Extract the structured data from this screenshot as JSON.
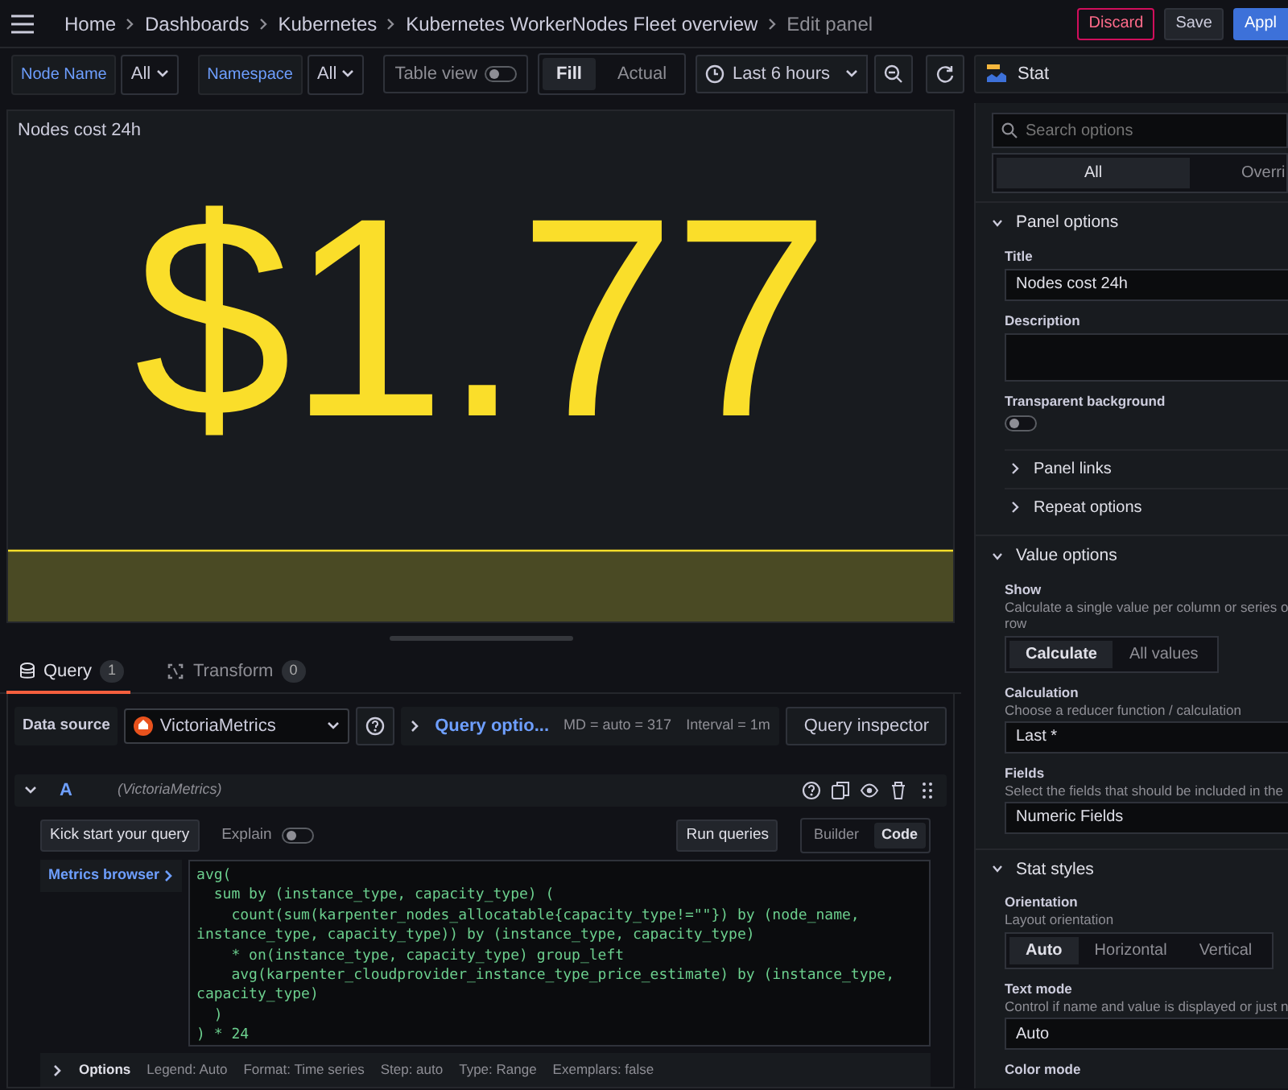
{
  "topbar": {
    "breadcrumbs": [
      "Home",
      "Dashboards",
      "Kubernetes",
      "Kubernetes WorkerNodes Fleet overview",
      "Edit panel"
    ],
    "buttons": [
      {
        "label": "Discard",
        "kind": "danger"
      },
      {
        "label": "Save",
        "kind": "secondary"
      },
      {
        "label": "Appl",
        "kind": "primary"
      }
    ]
  },
  "variables": [
    {
      "label": "Node Name",
      "value": "All"
    },
    {
      "label": "Namespace",
      "value": "All"
    }
  ],
  "table_view": {
    "label": "Table view",
    "on": false
  },
  "size_modes": [
    {
      "label": "Fill",
      "selected": true
    },
    {
      "label": "Actual",
      "selected": false
    }
  ],
  "time_range": "Last 6 hours",
  "visualization": {
    "name": "Stat"
  },
  "panel": {
    "title": "Nodes cost 24h",
    "value": "$1.77"
  },
  "query_tabs": [
    {
      "label": "Query",
      "count": "1",
      "selected": true
    },
    {
      "label": "Transform",
      "count": "0",
      "selected": false
    }
  ],
  "data_source": {
    "label": "Data source",
    "name": "VictoriaMetrics",
    "options_link": "Query optio...",
    "max_data_points": "MD = auto = 317",
    "interval": "Interval = 1m",
    "inspector": "Query inspector"
  },
  "query": {
    "ref": "A",
    "source": "(VictoriaMetrics)",
    "expanded": true,
    "kick_start": "Kick start your query",
    "explain": {
      "label": "Explain",
      "on": false
    },
    "run": "Run queries",
    "modes": [
      {
        "label": "Builder",
        "selected": false
      },
      {
        "label": "Code",
        "selected": true
      }
    ],
    "metrics_browser": "Metrics browser",
    "code_lines": [
      "avg(",
      "  sum by (instance_type, capacity_type) (",
      "    count(sum(karpenter_nodes_allocatable{capacity_type!=\"\"}) by (node_name,",
      "instance_type, capacity_type)) by (instance_type, capacity_type)",
      "    * on(instance_type, capacity_type) group_left",
      "    avg(karpenter_cloudprovider_instance_type_price_estimate) by (instance_type,",
      "capacity_type)",
      "  )",
      ") * 24"
    ],
    "options": {
      "label": "Options",
      "summary": [
        "Legend: Auto",
        "Format: Time series",
        "Step: auto",
        "Type: Range",
        "Exemplars: false"
      ]
    }
  },
  "options_pane": {
    "search_placeholder": "Search options",
    "tabs": [
      {
        "label": "All",
        "selected": true
      },
      {
        "label": "Overri",
        "selected": false
      }
    ],
    "sections": [
      {
        "title": "Panel options",
        "expanded": true,
        "items": [
          {
            "kind": "input",
            "label": "Title",
            "value": "Nodes cost 24h"
          },
          {
            "kind": "textarea",
            "label": "Description"
          },
          {
            "kind": "switch",
            "label": "Transparent background",
            "on": false
          },
          {
            "kind": "subsection",
            "label": "Panel links",
            "expanded": false
          },
          {
            "kind": "subsection",
            "label": "Repeat options",
            "expanded": false
          }
        ]
      },
      {
        "title": "Value options",
        "expanded": true,
        "items": [
          {
            "kind": "radio",
            "label": "Show",
            "description": [
              "Calculate a single value per column or series o",
              "row"
            ],
            "options": [
              {
                "label": "Calculate",
                "selected": true
              },
              {
                "label": "All values",
                "selected": false
              }
            ]
          },
          {
            "kind": "input",
            "label": "Calculation",
            "description": [
              "Choose a reducer function / calculation"
            ],
            "value": "Last *"
          },
          {
            "kind": "input",
            "label": "Fields",
            "description": [
              "Select the fields that should be included in the"
            ],
            "value": "Numeric Fields"
          }
        ]
      },
      {
        "title": "Stat styles",
        "expanded": true,
        "items": [
          {
            "kind": "radio",
            "label": "Orientation",
            "description": [
              "Layout orientation"
            ],
            "options": [
              {
                "label": "Auto",
                "selected": true
              },
              {
                "label": "Horizontal",
                "selected": false
              },
              {
                "label": "Vertical",
                "selected": false
              }
            ]
          },
          {
            "kind": "input",
            "label": "Text mode",
            "description": [
              "Control if name and value is displayed or just n"
            ],
            "value": "Auto"
          },
          {
            "kind": "label",
            "label": "Color mode"
          }
        ]
      }
    ]
  }
}
